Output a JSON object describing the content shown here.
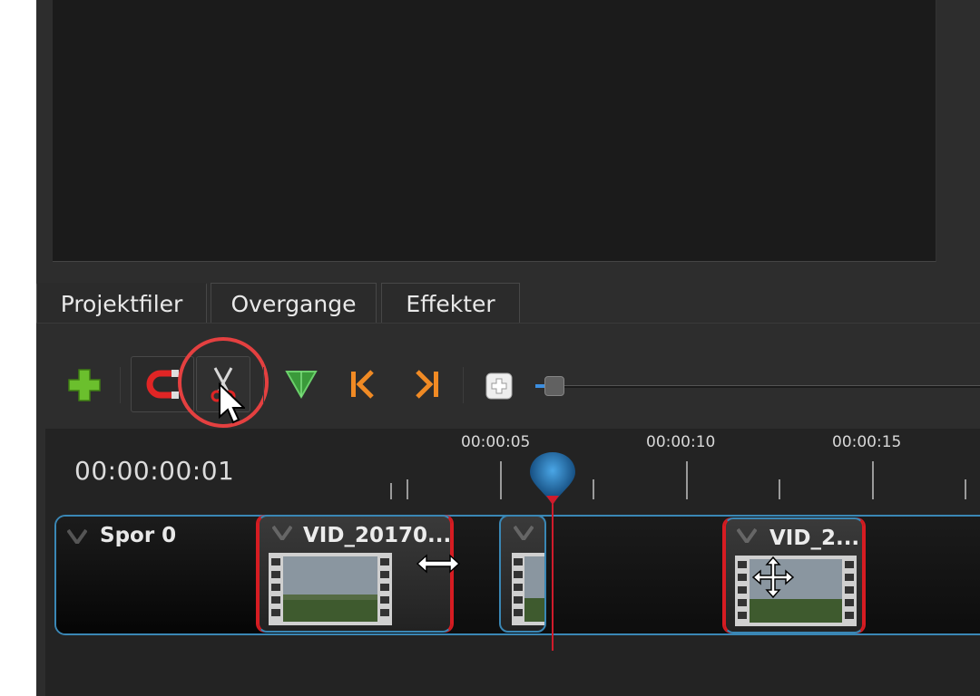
{
  "tabs": [
    {
      "label": "Projektfiler"
    },
    {
      "label": "Overgange"
    },
    {
      "label": "Effekter"
    }
  ],
  "toolbar": {
    "buttons": [
      "add-track",
      "snapping",
      "razor",
      "add-marker",
      "previous-marker",
      "next-marker",
      "zoom"
    ],
    "zoom_level": 0.05
  },
  "timeline": {
    "current_time": "00:00:00:01",
    "ruler_labels": [
      "00:00:05",
      "00:00:10",
      "00:00:15"
    ],
    "track": {
      "name": "Spor 0"
    },
    "clips": [
      {
        "title": "VID_20170...",
        "selected": true
      },
      {
        "title": "",
        "selected": false
      },
      {
        "title": "VID_2...",
        "selected": true
      }
    ]
  },
  "colors": {
    "accent_blue": "#3a87b5",
    "selection_red": "#d61c22",
    "playhead": "#d01b2b",
    "highlight_circle": "#e44040",
    "add_green": "#6bbf2d",
    "marker_orange": "#f08a24"
  }
}
